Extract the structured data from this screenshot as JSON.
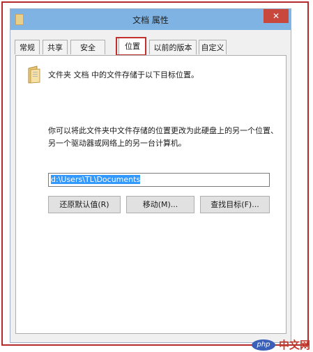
{
  "window": {
    "title": "文档 属性",
    "close_glyph": "✕"
  },
  "tabs": [
    {
      "label": "常规"
    },
    {
      "label": "共享"
    },
    {
      "label": "安全"
    },
    {
      "label": "位置"
    },
    {
      "label": "以前的版本"
    },
    {
      "label": "自定义"
    }
  ],
  "active_tab": "位置",
  "panel": {
    "info": "文件夹 文档 中的文件存储于以下目标位置。",
    "description": "你可以将此文件夹中文件存储的位置更改为此硬盘上的另一个位置、另一个驱动器或网络上的另一台计算机。",
    "path_value": "d:\\Users\\TL\\Documents",
    "restore_label": "还原默认值(R)",
    "move_label": "移动(M)...",
    "find_label": "查找目标(F)..."
  },
  "watermark": {
    "logo_text": "php",
    "text": "中文网"
  },
  "colors": {
    "highlight": "#c0302e",
    "titlebar": "#7fb3e3",
    "selection": "#3399ff"
  }
}
